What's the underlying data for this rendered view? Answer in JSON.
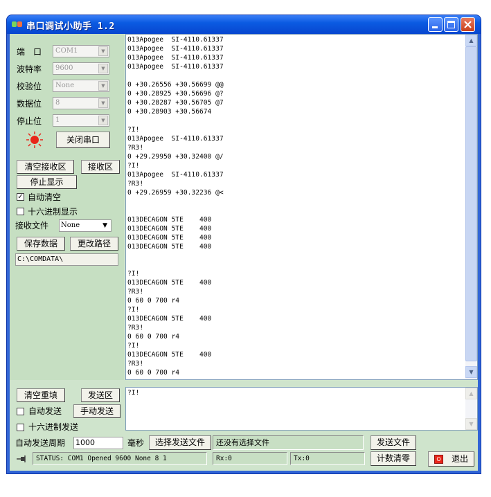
{
  "window": {
    "title": "串口调试小助手 1.2"
  },
  "settings": {
    "port": {
      "label": "端　口",
      "value": "COM1"
    },
    "baud": {
      "label": "波特率",
      "value": "9600"
    },
    "parity": {
      "label": "校验位",
      "value": "None"
    },
    "databits": {
      "label": "数据位",
      "value": "8"
    },
    "stopbits": {
      "label": "停止位",
      "value": "1"
    },
    "close_port_button": "关闭串口"
  },
  "receive_controls": {
    "clear_button": "清空接收区",
    "area_label_button": "接收区",
    "stop_display_button": "停止显示",
    "auto_clear": {
      "label": "自动清空",
      "checked": true
    },
    "hex_display": {
      "label": "十六进制显示",
      "checked": false
    },
    "file_label": "接收文件",
    "file_type": "None",
    "save_button": "保存数据",
    "change_path_button": "更改路径",
    "path": "C:\\COMDATA\\"
  },
  "receive_lines": [
    "013Apogee  SI-4110.61337",
    "013Apogee  SI-4110.61337",
    "013Apogee  SI-4110.61337",
    "013Apogee  SI-4110.61337",
    "",
    "0 +30.26556 +30.56699 @@",
    "0 +30.28925 +30.56696 @?",
    "0 +30.28287 +30.56705 @7",
    "0 +30.28903 +30.56674",
    "",
    "?I!",
    "013Apogee  SI-4110.61337",
    "?R3!",
    "0 +29.29950 +30.32400 @/",
    "?I!",
    "013Apogee  SI-4110.61337",
    "?R3!",
    "0 +29.26959 +30.32236 @<",
    "",
    "",
    "013DECAGON 5TE    400",
    "013DECAGON 5TE    400",
    "013DECAGON 5TE    400",
    "013DECAGON 5TE    400",
    "",
    "",
    "?I!",
    "013DECAGON 5TE    400",
    "?R3!",
    "0 60 0 700 r4",
    "?I!",
    "013DECAGON 5TE    400",
    "?R3!",
    "0 60 0 700 r4",
    "?I!",
    "013DECAGON 5TE    400",
    "?R3!",
    "0 60 0 700 r4"
  ],
  "send_controls": {
    "clear_button": "清空重填",
    "area_label_button": "发送区",
    "auto_send": {
      "label": "自动发送",
      "checked": false
    },
    "manual_send_button": "手动发送",
    "hex_send": {
      "label": "十六进制发送",
      "checked": false
    },
    "send_text": "?I!"
  },
  "bottom": {
    "period_label": "自动发送周期",
    "period_value": "1000",
    "ms_label": "毫秒",
    "choose_file_button": "选择发送文件",
    "file_status": "还没有选择文件",
    "send_file_button": "发送文件",
    "status": "STATUS: COM1 Opened 9600 None 8 1",
    "rx": "Rx:0",
    "tx": "Tx:0",
    "reset_count_button": "计数清零",
    "exit_button": "退出"
  },
  "colors": {
    "titlebar": "#0b5be2",
    "panel": "#c6dfc2",
    "indicator": "#e8261a"
  }
}
